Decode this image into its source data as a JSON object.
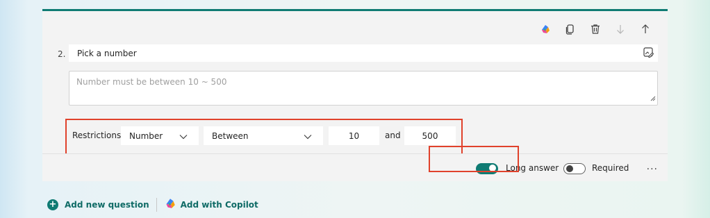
{
  "question": {
    "number": "2.",
    "title": "Pick a number",
    "answer_placeholder": "Number must be between 10 ~ 500"
  },
  "toolbar": {
    "icons": [
      "copilot-icon",
      "copy-icon",
      "delete-icon",
      "move-down-icon",
      "move-up-icon"
    ]
  },
  "restrictions": {
    "label": "Restrictions",
    "type_value": "Number",
    "condition_value": "Between",
    "min_value": "10",
    "and_label": "and",
    "max_value": "500"
  },
  "footer": {
    "long_answer_label": "Long answer",
    "long_answer_on": true,
    "required_label": "Required",
    "required_on": false,
    "more_label": "···"
  },
  "bottom": {
    "add_question_label": "Add new question",
    "add_copilot_label": "Add with Copilot"
  },
  "colors": {
    "accent": "#0f7b73",
    "highlight": "#e0412b"
  }
}
